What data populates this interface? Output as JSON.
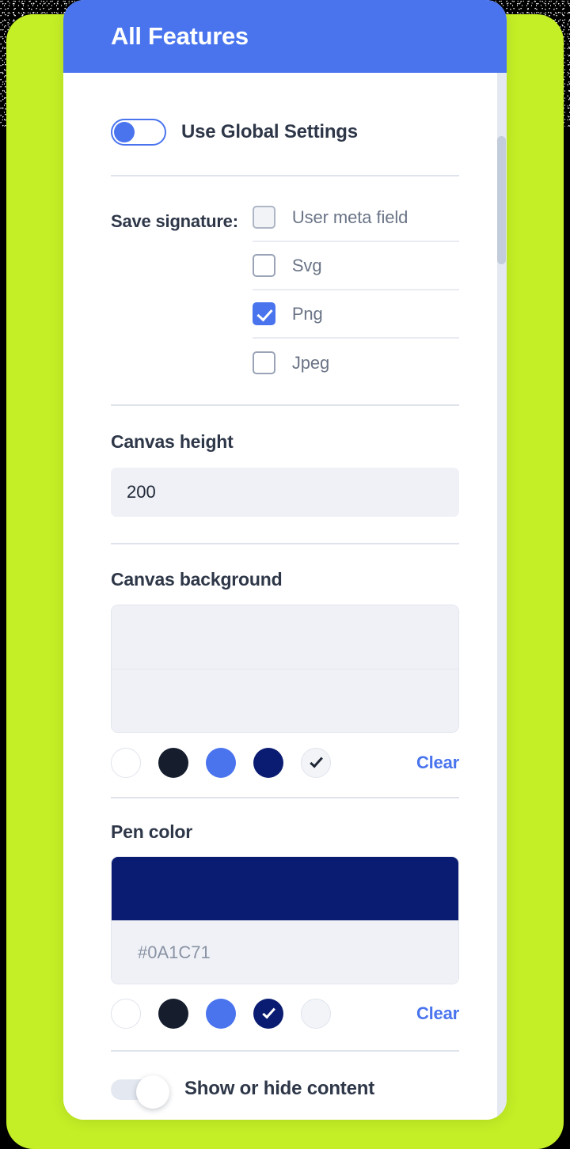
{
  "background": {
    "outer_color": "#000000",
    "panel_color": "#C4EF26"
  },
  "card": {
    "header": {
      "title": "All Features",
      "bg_color": "#4A74EE",
      "text_color": "#FFFFFF"
    },
    "accent_color": "#4A74EE"
  },
  "global_toggle": {
    "label": "Use Global Settings",
    "state": "on"
  },
  "save_signature": {
    "label": "Save signature:",
    "options": [
      {
        "label": "User meta field",
        "checked": false,
        "disabled": true
      },
      {
        "label": "Svg",
        "checked": false,
        "disabled": false
      },
      {
        "label": "Png",
        "checked": true,
        "disabled": false
      },
      {
        "label": "Jpeg",
        "checked": false,
        "disabled": false
      }
    ]
  },
  "canvas_height": {
    "title": "Canvas height",
    "value": "200"
  },
  "canvas_background": {
    "title": "Canvas background",
    "preview_color": "#EFF1F6",
    "value": "",
    "placeholder": "",
    "clear_label": "Clear",
    "swatches": [
      {
        "color": "#FFFFFF",
        "selected": false,
        "check_color": "#1F2736"
      },
      {
        "color": "#161E2E",
        "selected": false,
        "check_color": "#FFFFFF"
      },
      {
        "color": "#4A74EE",
        "selected": false,
        "check_color": "#FFFFFF"
      },
      {
        "color": "#0A1C71",
        "selected": false,
        "check_color": "#FFFFFF"
      },
      {
        "color": "#F2F4F8",
        "selected": true,
        "check_color": "#1F2736"
      }
    ]
  },
  "pen_color": {
    "title": "Pen color",
    "preview_color": "#0A1C71",
    "value": "#0A1C71",
    "clear_label": "Clear",
    "swatches": [
      {
        "color": "#FFFFFF",
        "selected": false,
        "check_color": "#1F2736"
      },
      {
        "color": "#161E2E",
        "selected": false,
        "check_color": "#FFFFFF"
      },
      {
        "color": "#4A74EE",
        "selected": false,
        "check_color": "#FFFFFF"
      },
      {
        "color": "#0A1C71",
        "selected": true,
        "check_color": "#FFFFFF"
      },
      {
        "color": "#F2F4F8",
        "selected": false,
        "check_color": "#1F2736"
      }
    ]
  },
  "show_hide_toggle": {
    "label": "Show or hide content",
    "state": "off"
  },
  "scrollbar": {
    "track_color": "#E4E8F0",
    "thumb_color": "#C3CCDA"
  }
}
